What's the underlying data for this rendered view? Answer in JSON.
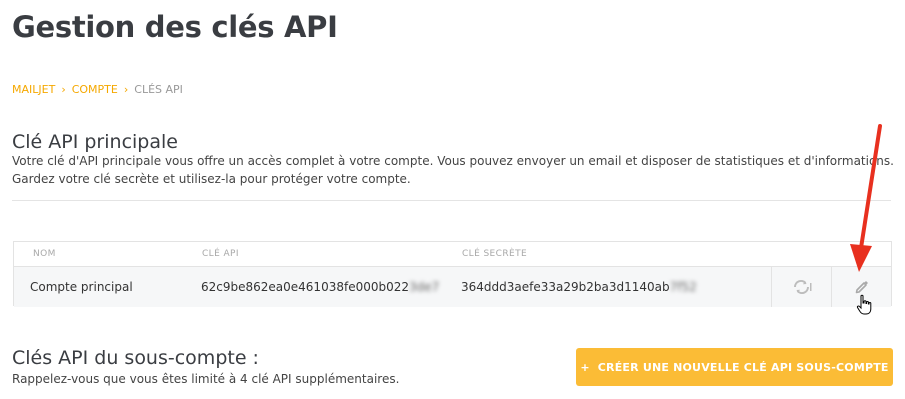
{
  "page": {
    "title": "Gestion des clés API"
  },
  "breadcrumb": [
    "MAILJET",
    "COMPTE",
    "CLÉS API"
  ],
  "main_key": {
    "title": "Clé API principale",
    "description_line1": "Votre clé d'API principale vous offre un accès complet à votre compte. Vous pouvez envoyer un email et disposer de statistiques et d'informations.",
    "description_line2": "Gardez votre clé secrète et utilisez-la pour protéger votre compte."
  },
  "table": {
    "headers": [
      "NOM",
      "CLÉ API",
      "CLÉ SECRÈTE"
    ],
    "row": {
      "name": "Compte principal",
      "api_key": "62c9be862ea0e461038fe000b022",
      "api_key_hidden": "3de7",
      "secret_key": "364ddd3aefe33a29b2ba3d1140ab",
      "secret_key_hidden": "7f52"
    },
    "actions": [
      "regenerate-icon",
      "pencil-icon"
    ]
  },
  "sub_account": {
    "title": "Clés API du sous-compte :",
    "description": "Rappelez-vous que vous êtes limité à 4 clé API supplémentaires.",
    "button_label": "CRÉER UNE NOUVELLE CLÉ API SOUS-COMPTE",
    "button_icon": "+"
  },
  "colors": {
    "accent": "#f5a800",
    "button": "#fbbc36",
    "annotation_arrow": "#e8301f"
  }
}
